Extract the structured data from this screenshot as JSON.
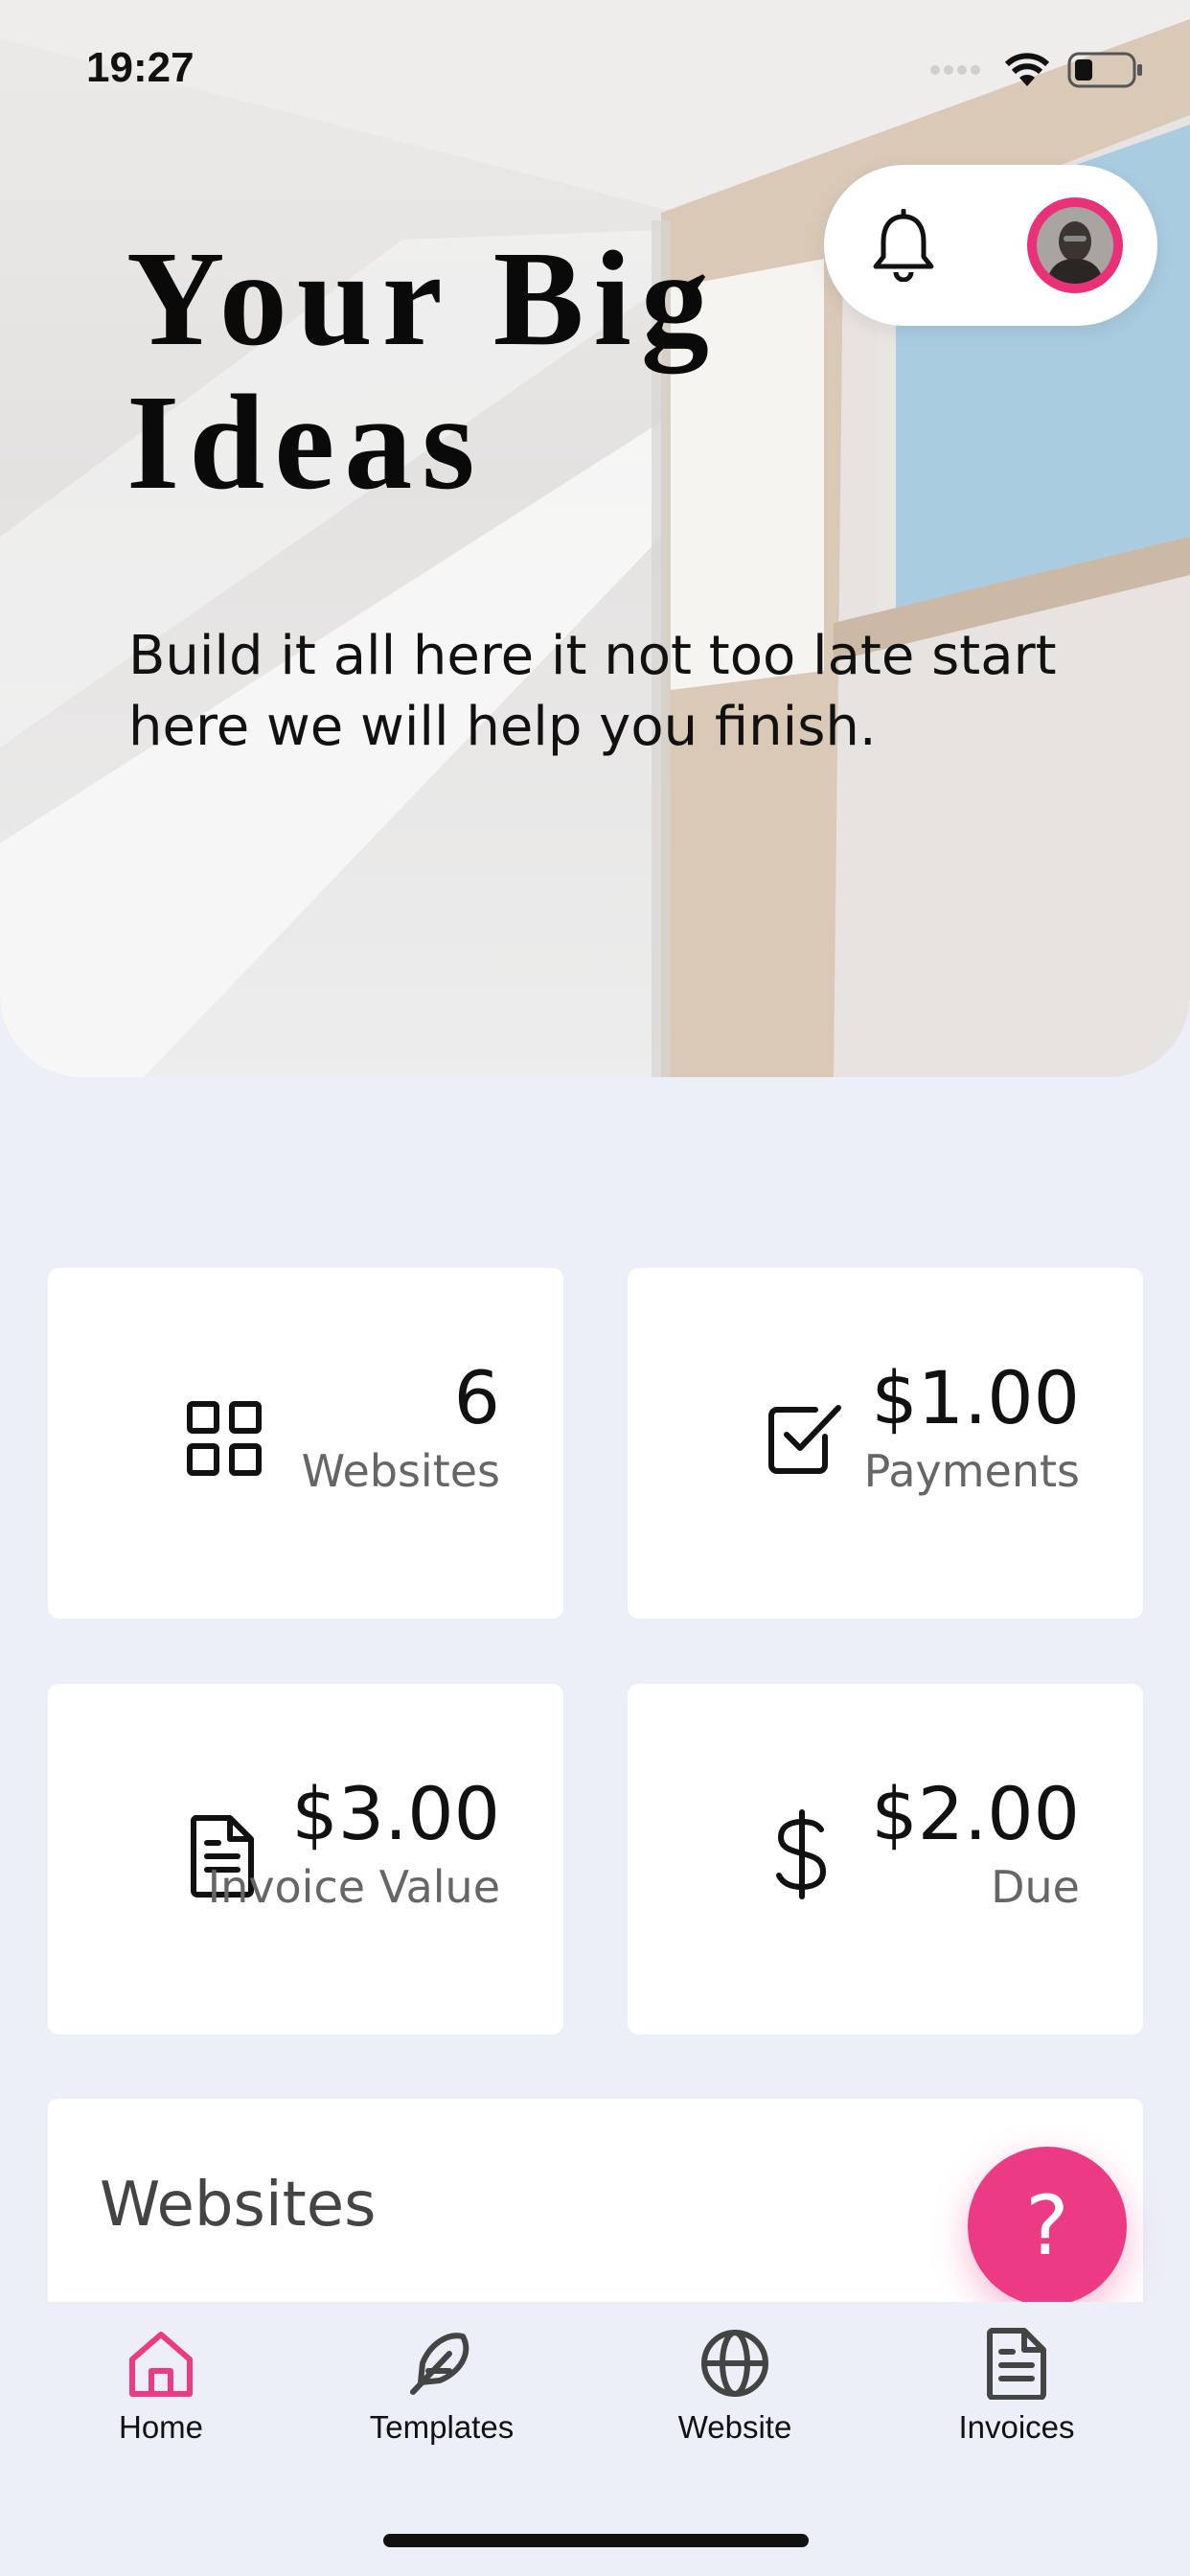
{
  "status_bar": {
    "time": "19:27"
  },
  "hero": {
    "title": "Your Big Ideas",
    "subtitle": "Build it all here it not too late start here we will help you finish."
  },
  "stats": [
    {
      "value": "6",
      "label": "Websites",
      "icon": "grid-icon"
    },
    {
      "value": "$1.00",
      "label": "Payments",
      "icon": "checkbox-icon"
    },
    {
      "value": "$3.00",
      "label": "Invoice Value",
      "icon": "document-icon"
    },
    {
      "value": "$2.00",
      "label": "Due",
      "icon": "dollar-icon"
    }
  ],
  "section": {
    "title": "Websites"
  },
  "fab": {
    "label": "?"
  },
  "tabs": [
    {
      "label": "Home",
      "icon": "home-icon",
      "active": true
    },
    {
      "label": "Templates",
      "icon": "feather-icon",
      "active": false
    },
    {
      "label": "Website",
      "icon": "globe-icon",
      "active": false
    },
    {
      "label": "Invoices",
      "icon": "invoice-icon",
      "active": false
    }
  ],
  "colors": {
    "accent": "#EC3A84",
    "background": "#ECEFF7",
    "card": "#FFFFFF"
  }
}
